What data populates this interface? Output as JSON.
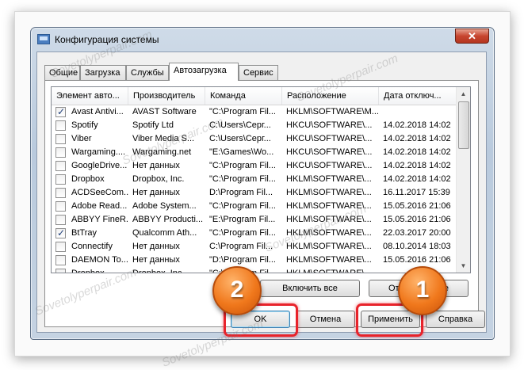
{
  "window": {
    "title": "Конфигурация системы",
    "close_label": "✕"
  },
  "tabs": [
    {
      "label": "Общие"
    },
    {
      "label": "Загрузка"
    },
    {
      "label": "Службы"
    },
    {
      "label": "Автозагрузка"
    },
    {
      "label": "Сервис"
    }
  ],
  "columns": [
    "Элемент авто...",
    "Производитель",
    "Команда",
    "Расположение",
    "Дата отключ..."
  ],
  "rows": [
    {
      "checked": true,
      "name": "Avast Antivi...",
      "vendor": "AVAST Software",
      "command": "\"C:\\Program Fil...",
      "location": "HKLM\\SOFTWARE\\M...",
      "date": ""
    },
    {
      "checked": false,
      "name": "Spotify",
      "vendor": "Spotify Ltd",
      "command": "C:\\Users\\Серг...",
      "location": "HKCU\\SOFTWARE\\...",
      "date": "14.02.2018 14:02"
    },
    {
      "checked": false,
      "name": "Viber",
      "vendor": "Viber Media S...",
      "command": "C:\\Users\\Серг...",
      "location": "HKCU\\SOFTWARE\\...",
      "date": "14.02.2018 14:02"
    },
    {
      "checked": false,
      "name": "Wargaming....",
      "vendor": "Wargaming.net",
      "command": "\"E:\\Games\\Wo...",
      "location": "HKCU\\SOFTWARE\\...",
      "date": "14.02.2018 14:02"
    },
    {
      "checked": false,
      "name": "GoogleDrive...",
      "vendor": "Нет данных",
      "command": "\"C:\\Program Fil...",
      "location": "HKCU\\SOFTWARE\\...",
      "date": "14.02.2018 14:02"
    },
    {
      "checked": false,
      "name": "Dropbox",
      "vendor": "Dropbox, Inc.",
      "command": "\"C:\\Program Fil...",
      "location": "HKLM\\SOFTWARE\\...",
      "date": "14.02.2018 14:02"
    },
    {
      "checked": false,
      "name": "ACDSeeCom...",
      "vendor": "Нет данных",
      "command": "D:\\Program Fil...",
      "location": "HKLM\\SOFTWARE\\...",
      "date": "16.11.2017 15:39"
    },
    {
      "checked": false,
      "name": "Adobe Read...",
      "vendor": "Adobe System...",
      "command": "\"C:\\Program Fil...",
      "location": "HKLM\\SOFTWARE\\...",
      "date": "15.05.2016 21:06"
    },
    {
      "checked": false,
      "name": "ABBYY FineR...",
      "vendor": "ABBYY Producti...",
      "command": "\"E:\\Program Fil...",
      "location": "HKLM\\SOFTWARE\\...",
      "date": "15.05.2016 21:06"
    },
    {
      "checked": true,
      "name": "BtTray",
      "vendor": "Qualcomm Ath...",
      "command": "\"C:\\Program Fil...",
      "location": "HKLM\\SOFTWARE\\...",
      "date": "22.03.2017 20:00"
    },
    {
      "checked": false,
      "name": "Connectify",
      "vendor": "Нет данных",
      "command": "C:\\Program Fil...",
      "location": "HKLM\\SOFTWARE\\...",
      "date": "08.10.2014 18:03"
    },
    {
      "checked": false,
      "name": "DAEMON To...",
      "vendor": "Нет данных",
      "command": "\"D:\\Program Fil...",
      "location": "HKLM\\SOFTWARE\\...",
      "date": "15.05.2016 21:06"
    },
    {
      "checked": false,
      "name": "Dropbox",
      "vendor": "Dropbox, Inc.",
      "command": "\"C:\\Program Fil...",
      "location": "HKLM\\SOFTWARE\\...",
      "date": ""
    }
  ],
  "panel_buttons": {
    "enable_all": "Включить все",
    "disable_all": "Отключить все"
  },
  "footer_buttons": {
    "ok": "OK",
    "cancel": "Отмена",
    "apply": "Применить",
    "help": "Справка"
  },
  "badges": {
    "first": "1",
    "second": "2"
  },
  "watermark": {
    "text": "Sovetolyperpair.com"
  },
  "colors": {
    "highlight": "#e8232b",
    "badge": "#f0781c",
    "close_button": "#c7452f"
  }
}
